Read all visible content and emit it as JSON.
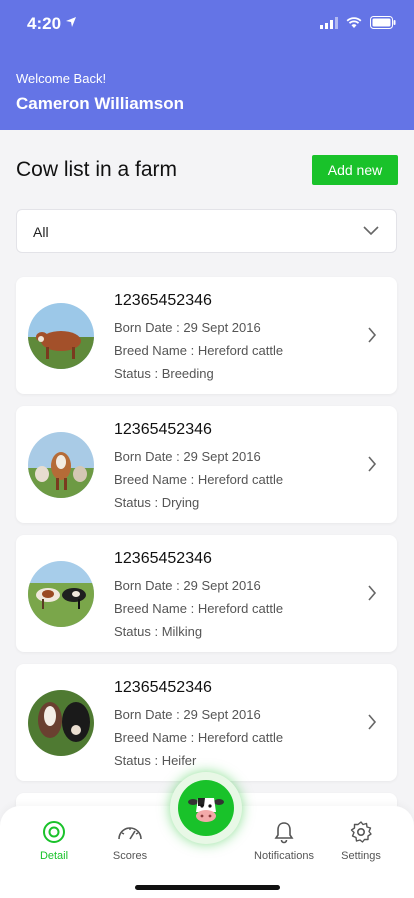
{
  "status_bar": {
    "time": "4:20"
  },
  "header": {
    "welcome": "Welcome  Back!",
    "user_name": "Cameron Williamson"
  },
  "page": {
    "title": "Cow list in a farm",
    "add_button": "Add new"
  },
  "filter": {
    "value": "All"
  },
  "cows": [
    {
      "id": "12365452346",
      "born": "Born Date : 29 Sept 2016",
      "breed": "Breed Name : Hereford cattle",
      "status": "Status : Breeding"
    },
    {
      "id": "12365452346",
      "born": "Born Date : 29 Sept 2016",
      "breed": "Breed Name : Hereford cattle",
      "status": "Status : Drying"
    },
    {
      "id": "12365452346",
      "born": "Born Date : 29 Sept 2016",
      "breed": "Breed Name : Hereford cattle",
      "status": "Status : Milking"
    },
    {
      "id": "12365452346",
      "born": "Born Date : 29 Sept 2016",
      "breed": "Breed Name : Hereford cattle",
      "status": "Status : Heifer"
    }
  ],
  "nav": {
    "detail": "Detail",
    "scores": "Scores",
    "notifications": "Notifications",
    "settings": "Settings"
  },
  "colors": {
    "header": "#6474e6",
    "accent": "#19c22a"
  }
}
